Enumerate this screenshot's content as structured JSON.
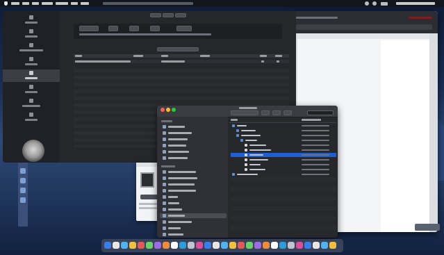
{
  "theme": {
    "menubar_bg": "#12151c",
    "window_bg": "#2a2c30",
    "titlebar_bg": "#3a3c41",
    "sidebar_bg": "#1f2126",
    "selected_row": "#1f5fd6",
    "traffic_red": "#ff5f57",
    "traffic_yellow": "#febc2e",
    "traffic_green": "#28c840",
    "accent": "#2f6ff0"
  },
  "icons": {
    "apple": "apple-icon",
    "wifi": "wifi-icon",
    "battery": "battery-icon",
    "search": "search-icon",
    "control_center": "control-center-icon",
    "folder": "folder-icon",
    "file": "file-icon",
    "disk": "disk-icon"
  },
  "menubar": {
    "items": [
      "",
      "",
      "",
      "",
      "",
      "",
      ""
    ],
    "status_text": ""
  },
  "back_window": {
    "title": "",
    "sidebar": [
      "",
      "",
      "",
      "",
      "",
      "",
      "",
      "",
      "",
      ""
    ],
    "toolbar_tabs": [
      "",
      "",
      "",
      ""
    ],
    "columns": [
      "",
      "",
      "",
      "",
      "",
      ""
    ],
    "rows": [
      {
        "name": "",
        "type": "",
        "size": "",
        "format": "",
        "active": "",
        "folder": ""
      }
    ]
  },
  "finder": {
    "title": "",
    "search_placeholder": "",
    "sidebar_favorites": [
      "",
      "",
      "",
      "",
      "",
      ""
    ],
    "sidebar_locations": [
      "",
      "",
      "",
      "",
      "",
      "",
      "",
      "",
      "",
      "",
      "",
      "",
      "",
      ""
    ],
    "columns": [
      "",
      ""
    ],
    "rows": [
      {
        "name": "",
        "date": "",
        "depth": 0
      },
      {
        "name": "",
        "date": "",
        "depth": 1
      },
      {
        "name": "",
        "date": "",
        "depth": 1
      },
      {
        "name": "",
        "date": "",
        "depth": 2
      },
      {
        "name": "",
        "date": "",
        "depth": 3
      },
      {
        "name": "",
        "date": "",
        "depth": 3
      },
      {
        "name": "",
        "date": "",
        "depth": 3,
        "selected": true
      },
      {
        "name": "",
        "date": "",
        "depth": 3
      },
      {
        "name": "",
        "date": "",
        "depth": 3
      },
      {
        "name": "",
        "date": "",
        "depth": 3
      },
      {
        "name": "",
        "date": "",
        "depth": 0
      }
    ]
  },
  "preview": {
    "tab_label": "",
    "button_label": ""
  },
  "dock": {
    "app_count": 28
  }
}
